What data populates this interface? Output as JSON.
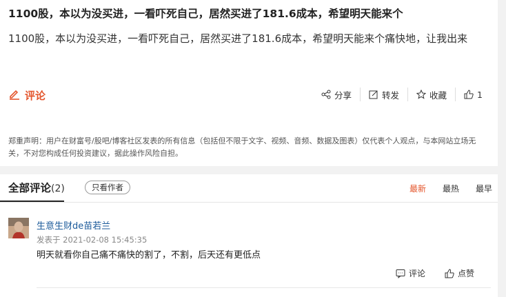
{
  "post": {
    "title": "1100股，本以为没买进，一看吓死自己，居然买进了181.6成本，希望明天能来个",
    "body": "1100股，本以为没买进，一看吓死自己，居然买进了181.6成本，希望明天能来个痛快地，让我出来",
    "comment_label": "评论",
    "share_label": "分享",
    "repost_label": "转发",
    "favorite_label": "收藏",
    "like_count": "1",
    "disclaimer": "郑重声明：用户在财富号/股吧/博客社区发表的所有信息（包括但不限于文字、视频、音频、数据及图表）仅代表个人观点，与本网站立场无关，不对您构成任何投资建议，据此操作风险自担。"
  },
  "comments_section": {
    "title": "全部评论",
    "count": "(2)",
    "only_author_label": "只看作者",
    "sort_options": [
      "最新",
      "最热",
      "最早"
    ],
    "active_sort": "最新"
  },
  "comments": [
    {
      "user": "生意生财de苗若兰",
      "date": "发表于 2021-02-08 15:45:35",
      "text": "明天就看你自己痛不痛快的割了，不割，后天还有更低点",
      "reply_label": "评论",
      "like_label": "点赞"
    }
  ],
  "colors": {
    "accent": "#e4572e",
    "link": "#1b5a9a"
  }
}
